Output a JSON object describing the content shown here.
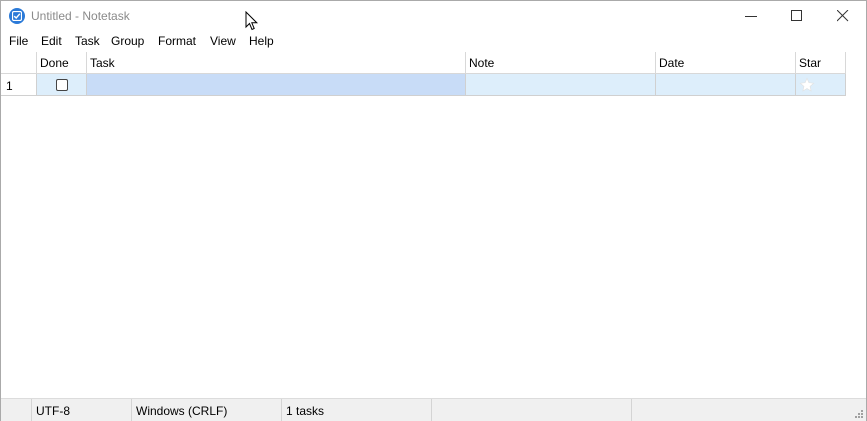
{
  "window": {
    "title": "Untitled - Notetask"
  },
  "menu": [
    "File",
    "Edit",
    "Task",
    "Group",
    "Format",
    "View",
    "Help"
  ],
  "grid": {
    "columns": [
      "Done",
      "Task",
      "Note",
      "Date",
      "Star"
    ],
    "rows": [
      {
        "number": "1",
        "done": false,
        "task": "",
        "note": "",
        "date": "",
        "starred": false
      }
    ]
  },
  "status": {
    "encoding": "UTF-8",
    "line_ending": "Windows (CRLF)",
    "task_count": "1 tasks"
  },
  "colors": {
    "accent": "#2b7ad8",
    "selection_row": "#ddeefb",
    "selection_cell": "#c8dcf7"
  },
  "icons": {
    "app": "notetask-app-icon",
    "minimize": "minimize-icon",
    "maximize": "maximize-icon",
    "close": "close-icon",
    "star": "star-icon",
    "grip": "resize-grip-icon"
  }
}
